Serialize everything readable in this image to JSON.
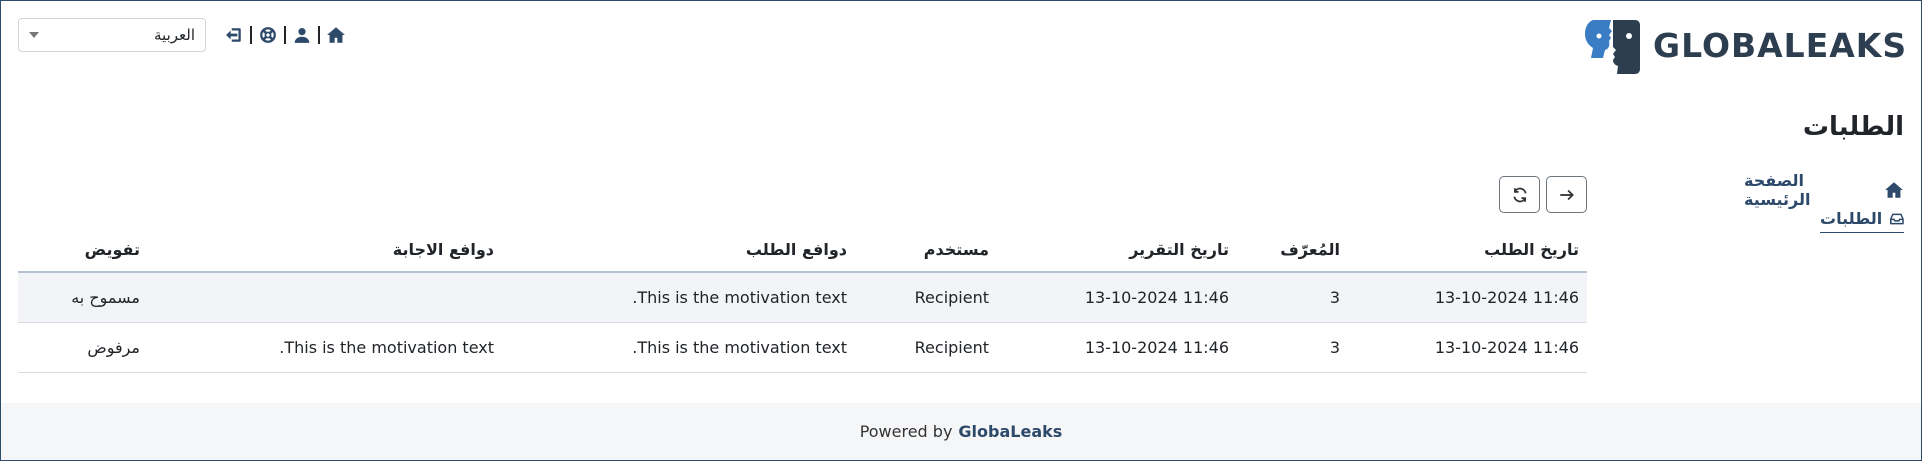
{
  "header": {
    "language": "العربية",
    "icons": [
      "home-icon",
      "user-icon",
      "support-icon",
      "logout-icon"
    ],
    "logo_text": "GLOBALEAKS"
  },
  "sidebar": {
    "title": "الطلبات",
    "items": [
      {
        "label": "الصفحة الرئيسية",
        "icon": "home-icon"
      },
      {
        "label": "الطلبات",
        "icon": "inbox-icon"
      }
    ]
  },
  "toolbar": {
    "icons": [
      "arrow-right-icon",
      "refresh-icon"
    ]
  },
  "table": {
    "headers": [
      "تاريخ الطلب",
      "المُعرّف",
      "تاريخ التقرير",
      "مستخدم",
      "دوافع الطلب",
      "دوافع الاجابة",
      "تفويض"
    ],
    "rows": [
      [
        "11:46 13-10-2024",
        "3",
        "11:46 13-10-2024",
        "Recipient",
        "This is the motivation text.",
        "",
        "مسموح به"
      ],
      [
        "11:46 13-10-2024",
        "3",
        "11:46 13-10-2024",
        "Recipient",
        "This is the motivation text.",
        "This is the motivation text.",
        "مرفوض"
      ]
    ]
  },
  "footer": {
    "prefix": "Powered by",
    "brand": "GlobaLeaks"
  },
  "colors": {
    "primary": "#2d4a6b",
    "logo_blue": "#3b7dc4",
    "row_highlight": "#f3f4f7"
  }
}
